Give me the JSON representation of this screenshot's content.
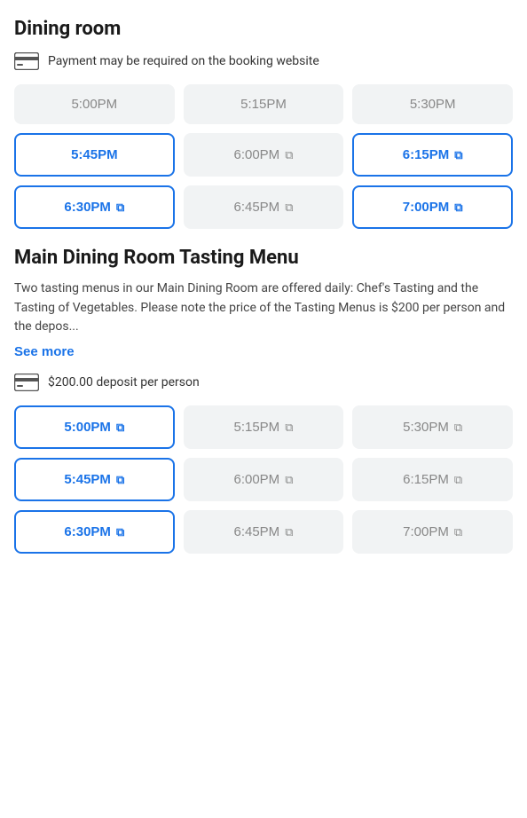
{
  "dining_room": {
    "section_title": "Dining room",
    "payment_notice": "Payment may be required on the booking website",
    "time_slots_1": [
      {
        "time": "5:00PM",
        "state": "unavailable",
        "external": false
      },
      {
        "time": "5:15PM",
        "state": "unavailable",
        "external": false
      },
      {
        "time": "5:30PM",
        "state": "unavailable",
        "external": false
      },
      {
        "time": "5:45PM",
        "state": "available",
        "external": false
      },
      {
        "time": "6:00PM",
        "state": "external",
        "external": true
      },
      {
        "time": "6:15PM",
        "state": "available-external",
        "external": true
      },
      {
        "time": "6:30PM",
        "state": "available-external",
        "external": true
      },
      {
        "time": "6:45PM",
        "state": "external",
        "external": true
      },
      {
        "time": "7:00PM",
        "state": "available-external",
        "external": true
      }
    ]
  },
  "tasting_menu": {
    "section_title": "Main Dining Room Tasting Menu",
    "description": "Two tasting menus in our Main Dining Room are offered daily: Chef's Tasting and the Tasting of Vegetables. Please note the price of the Tasting Menus is $200 per person and the depos...",
    "see_more_label": "See more",
    "deposit_notice": "$200.00 deposit per person",
    "time_slots_2": [
      {
        "time": "5:00PM",
        "state": "available-external",
        "external": true
      },
      {
        "time": "5:15PM",
        "state": "external",
        "external": true
      },
      {
        "time": "5:30PM",
        "state": "external",
        "external": true
      },
      {
        "time": "5:45PM",
        "state": "available-external",
        "external": true
      },
      {
        "time": "6:00PM",
        "state": "external",
        "external": true
      },
      {
        "time": "6:15PM",
        "state": "external",
        "external": true
      },
      {
        "time": "6:30PM",
        "state": "available-external",
        "external": true
      },
      {
        "time": "6:45PM",
        "state": "external",
        "external": true
      },
      {
        "time": "7:00PM",
        "state": "external",
        "external": true
      }
    ]
  },
  "icons": {
    "external_link": "⧉",
    "credit_card": "card"
  }
}
